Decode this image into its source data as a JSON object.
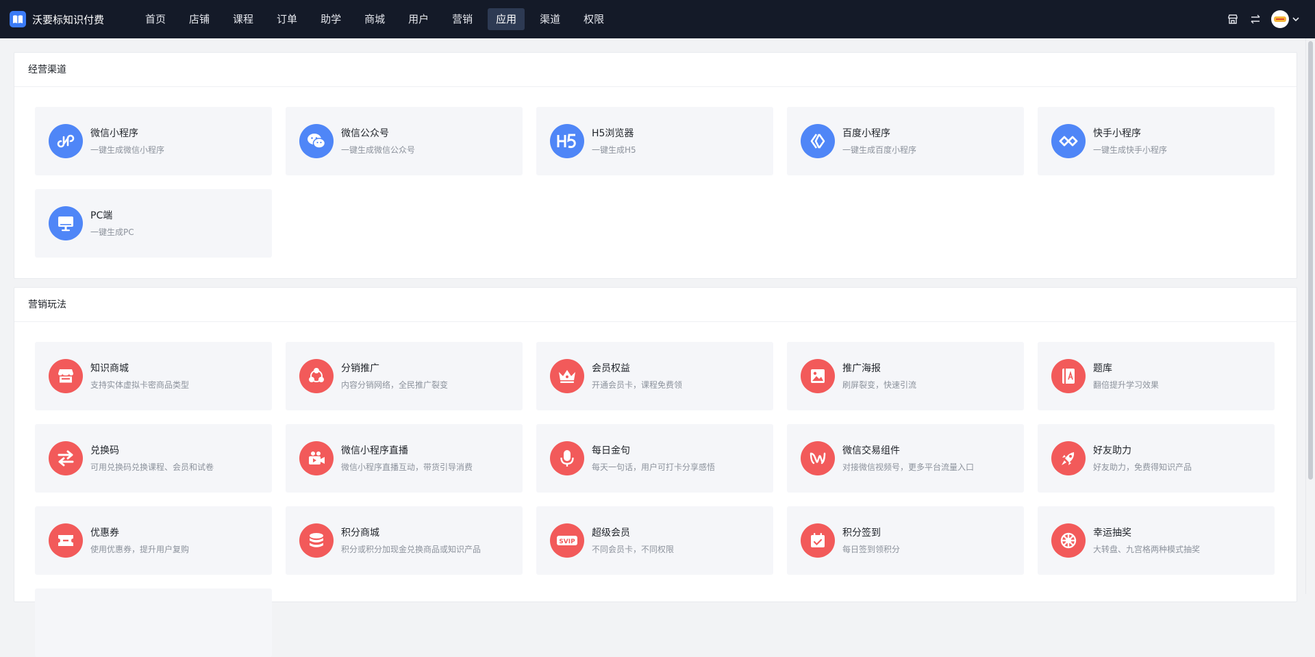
{
  "brand": {
    "name": "沃要标知识付费"
  },
  "nav": [
    {
      "label": "首页",
      "active": false
    },
    {
      "label": "店铺",
      "active": false
    },
    {
      "label": "课程",
      "active": false
    },
    {
      "label": "订单",
      "active": false
    },
    {
      "label": "助学",
      "active": false
    },
    {
      "label": "商城",
      "active": false
    },
    {
      "label": "用户",
      "active": false
    },
    {
      "label": "营销",
      "active": false
    },
    {
      "label": "应用",
      "active": true
    },
    {
      "label": "渠道",
      "active": false
    },
    {
      "label": "权限",
      "active": false
    }
  ],
  "topbar_icons": [
    "store-icon",
    "switch-icon",
    "avatar",
    "chevron-down-icon"
  ],
  "colors": {
    "topbar": "#141a28",
    "nav_active": "#2d3a53",
    "blue_icon": "#4f86f7",
    "red_icon": "#f25a5a"
  },
  "channels": {
    "title": "经营渠道",
    "items": [
      {
        "title": "微信小程序",
        "desc": "一键生成微信小程序",
        "icon": "mini-program-icon"
      },
      {
        "title": "微信公众号",
        "desc": "一键生成微信公众号",
        "icon": "wechat-icon"
      },
      {
        "title": "H5浏览器",
        "desc": "一键生成H5",
        "icon": "h5-icon"
      },
      {
        "title": "百度小程序",
        "desc": "一键生成百度小程序",
        "icon": "baidu-icon"
      },
      {
        "title": "快手小程序",
        "desc": "一键生成快手小程序",
        "icon": "kuaishou-icon"
      },
      {
        "title": "PC端",
        "desc": "一键生成PC",
        "icon": "monitor-icon"
      }
    ]
  },
  "marketing": {
    "title": "营销玩法",
    "items": [
      {
        "title": "知识商城",
        "desc": "支持实体虚拟卡密商品类型",
        "icon": "shop-icon"
      },
      {
        "title": "分销推广",
        "desc": "内容分销网络，全民推广裂变",
        "icon": "share-network-icon"
      },
      {
        "title": "会员权益",
        "desc": "开通会员卡，课程免费领",
        "icon": "crown-icon"
      },
      {
        "title": "推广海报",
        "desc": "刷屏裂变，快速引流",
        "icon": "poster-icon"
      },
      {
        "title": "题库",
        "desc": "翻倍提升学习效果",
        "icon": "question-bank-icon"
      },
      {
        "title": "兑换码",
        "desc": "可用兑换码兑换课程、会员和试卷",
        "icon": "exchange-icon"
      },
      {
        "title": "微信小程序直播",
        "desc": "微信小程序直播互动，带货引导消费",
        "icon": "live-video-icon"
      },
      {
        "title": "每日金句",
        "desc": "每天一句话，用户可打卡分享感悟",
        "icon": "microphone-icon"
      },
      {
        "title": "微信交易组件",
        "desc": "对接微信视频号，更多平台流量入口",
        "icon": "channels-icon"
      },
      {
        "title": "好友助力",
        "desc": "好友助力，免费得知识产品",
        "icon": "rocket-icon"
      },
      {
        "title": "优惠券",
        "desc": "使用优惠券，提升用户复购",
        "icon": "coupon-icon"
      },
      {
        "title": "积分商城",
        "desc": "积分或积分加现金兑换商品或知识产品",
        "icon": "coins-icon"
      },
      {
        "title": "超级会员",
        "desc": "不同会员卡，不同权限",
        "icon": "svip-icon"
      },
      {
        "title": "积分签到",
        "desc": "每日签到领积分",
        "icon": "calendar-check-icon"
      },
      {
        "title": "幸运抽奖",
        "desc": "大转盘、九宫格两种模式抽奖",
        "icon": "lottery-wheel-icon"
      }
    ]
  }
}
